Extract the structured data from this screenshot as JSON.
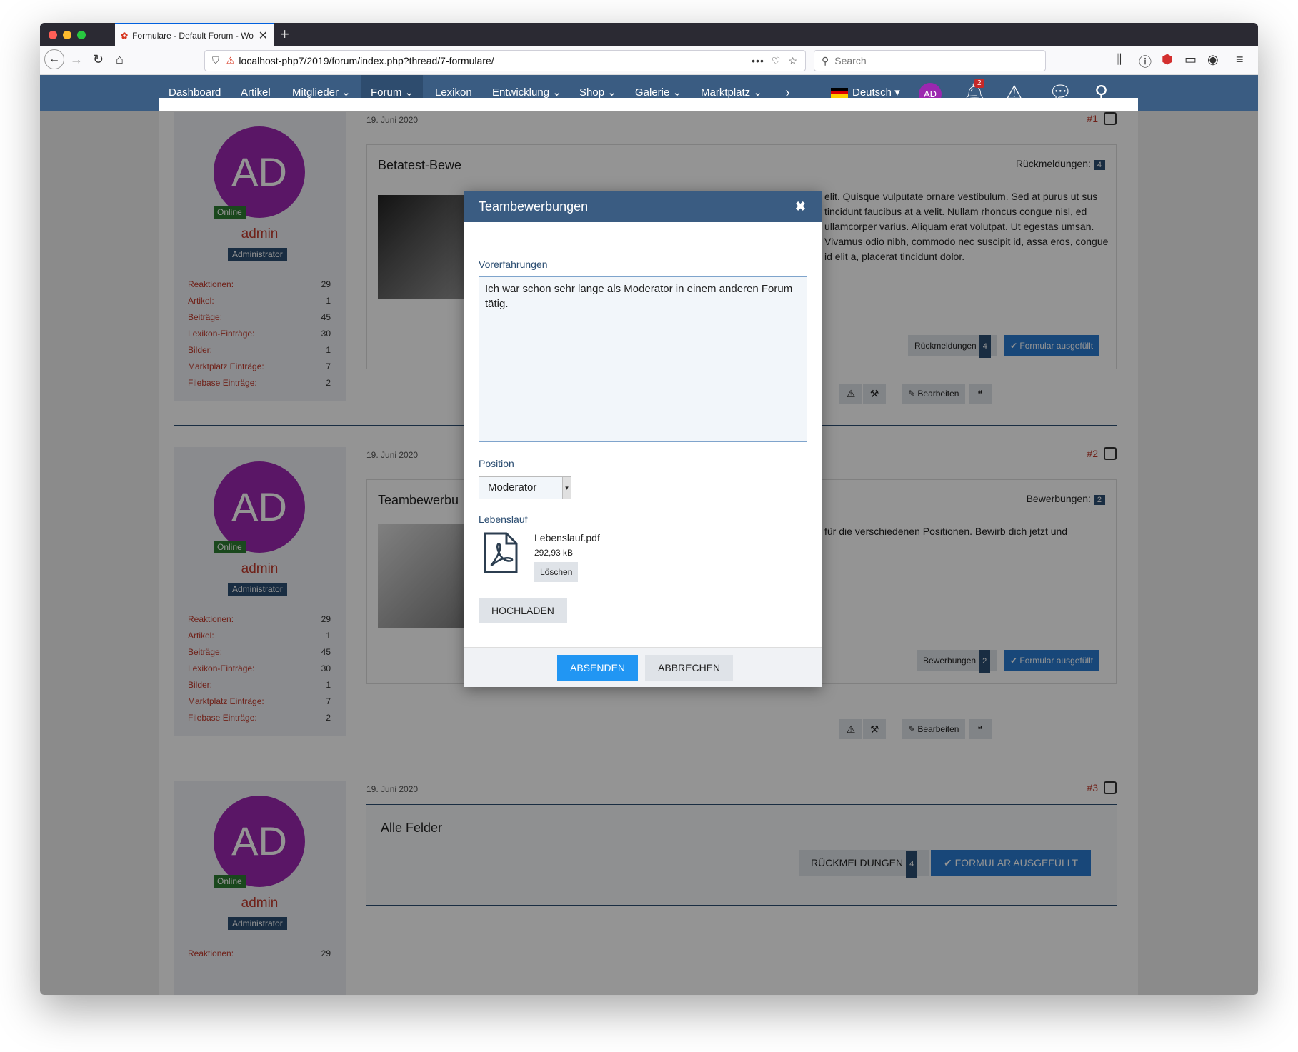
{
  "browser": {
    "tab_title": "Formulare - Default Forum - Wo",
    "url": "localhost-php7/2019/forum/index.php?thread/7-formulare/",
    "search_placeholder": "Search",
    "more": "•••"
  },
  "nav": {
    "items": [
      "Dashboard",
      "Artikel",
      "Mitglieder",
      "Forum",
      "Lexikon",
      "Entwicklung",
      "Shop",
      "Galerie",
      "Marktplatz"
    ],
    "language": "Deutsch",
    "avatar": "AD",
    "notifications": "2"
  },
  "user": {
    "avatar": "AD",
    "online": "Online",
    "name": "admin",
    "role": "Administrator",
    "stats": [
      {
        "k": "Reaktionen:",
        "v": "29"
      },
      {
        "k": "Artikel:",
        "v": "1"
      },
      {
        "k": "Beiträge:",
        "v": "45"
      },
      {
        "k": "Lexikon-Einträge:",
        "v": "30"
      },
      {
        "k": "Bilder:",
        "v": "1"
      },
      {
        "k": "Marktplatz Einträge:",
        "v": "7"
      },
      {
        "k": "Filebase Einträge:",
        "v": "2"
      }
    ]
  },
  "posts": [
    {
      "date": "19. Juni 2020",
      "num": "#1",
      "title": "Betatest-Bewe",
      "badge_label": "Rückmeldungen:",
      "badge_count": "4",
      "text": "elit. Quisque vulputate ornare vestibulum. Sed at purus ut sus tincidunt faucibus at a velit. Nullam rhoncus congue nisl, ed ullamcorper varius. Aliquam erat volutpat. Ut egestas umsan. Vivamus odio nibh, commodo nec suscipit id, assa eros, congue id elit a, placerat tincidunt dolor.",
      "btn_label": "Rückmeldungen",
      "btn_count": "4",
      "btn_filled": "Formular ausgefüllt",
      "edit": "Bearbeiten"
    },
    {
      "date": "19. Juni 2020",
      "num": "#2",
      "title": "Teambewerbu",
      "badge_label": "Bewerbungen:",
      "badge_count": "2",
      "text": "für die verschiedenen Positionen. Bewirb dich jetzt und",
      "btn_label": "Bewerbungen",
      "btn_count": "2",
      "btn_filled": "Formular ausgefüllt",
      "edit": "Bearbeiten"
    },
    {
      "date": "19. Juni 2020",
      "num": "#3",
      "title": "Alle Felder",
      "btn_label": "RÜCKMELDUNGEN",
      "btn_count": "4",
      "btn_filled": "FORMULAR AUSGEFÜLLT"
    }
  ],
  "dialog": {
    "title": "Teambewerbungen",
    "label_exp": "Vorerfahrungen",
    "exp_value": "Ich war schon sehr lange als Moderator in einem anderen Forum tätig.",
    "label_position": "Position",
    "position_value": "Moderator",
    "label_cv": "Lebenslauf",
    "file_name": "Lebenslauf.pdf",
    "file_size": "292,93 kB",
    "delete": "Löschen",
    "upload": "HOCHLADEN",
    "submit": "ABSENDEN",
    "cancel": "ABBRECHEN"
  },
  "colors": {
    "nav_bg": "#3a5c82",
    "avatar": "#9c27b0",
    "accent": "#2196f3",
    "online": "#2e7d32"
  }
}
